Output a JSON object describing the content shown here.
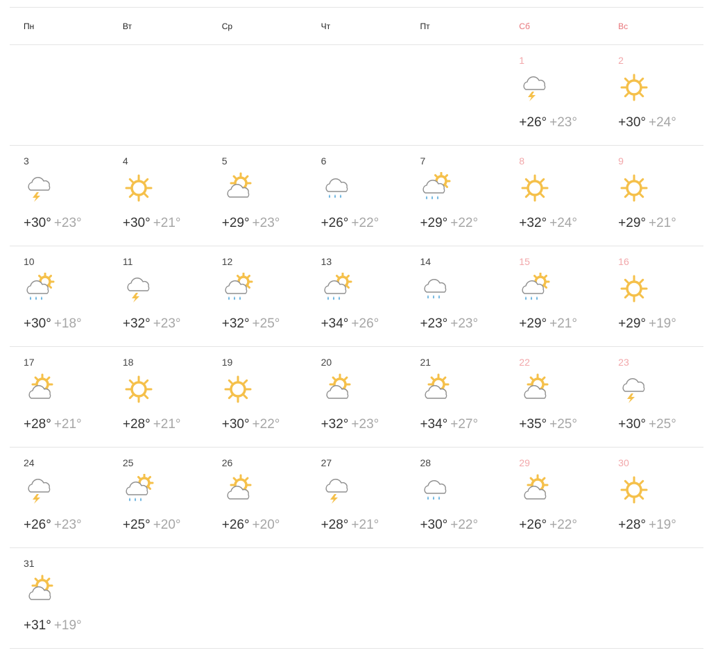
{
  "weekdays": [
    {
      "label": "Пн",
      "weekend": false
    },
    {
      "label": "Вт",
      "weekend": false
    },
    {
      "label": "Ср",
      "weekend": false
    },
    {
      "label": "Чт",
      "weekend": false
    },
    {
      "label": "Пт",
      "weekend": false
    },
    {
      "label": "Сб",
      "weekend": true
    },
    {
      "label": "Вс",
      "weekend": true
    }
  ],
  "weeks": [
    [
      null,
      null,
      null,
      null,
      null,
      {
        "day": "1",
        "icon": "thunder",
        "max": "+26°",
        "min": "+23°",
        "weekend": true
      },
      {
        "day": "2",
        "icon": "sun",
        "max": "+30°",
        "min": "+24°",
        "weekend": true
      }
    ],
    [
      {
        "day": "3",
        "icon": "thunder",
        "max": "+30°",
        "min": "+23°"
      },
      {
        "day": "4",
        "icon": "sun",
        "max": "+30°",
        "min": "+21°"
      },
      {
        "day": "5",
        "icon": "partly",
        "max": "+29°",
        "min": "+23°"
      },
      {
        "day": "6",
        "icon": "rain",
        "max": "+26°",
        "min": "+22°"
      },
      {
        "day": "7",
        "icon": "sunrain",
        "max": "+29°",
        "min": "+22°"
      },
      {
        "day": "8",
        "icon": "sun",
        "max": "+32°",
        "min": "+24°",
        "weekend": true
      },
      {
        "day": "9",
        "icon": "sun",
        "max": "+29°",
        "min": "+21°",
        "weekend": true
      }
    ],
    [
      {
        "day": "10",
        "icon": "sunrain",
        "max": "+30°",
        "min": "+18°"
      },
      {
        "day": "11",
        "icon": "thunder",
        "max": "+32°",
        "min": "+23°"
      },
      {
        "day": "12",
        "icon": "sunrain",
        "max": "+32°",
        "min": "+25°"
      },
      {
        "day": "13",
        "icon": "sunrain",
        "max": "+34°",
        "min": "+26°"
      },
      {
        "day": "14",
        "icon": "rain",
        "max": "+23°",
        "min": "+23°"
      },
      {
        "day": "15",
        "icon": "sunrain",
        "max": "+29°",
        "min": "+21°",
        "weekend": true
      },
      {
        "day": "16",
        "icon": "sun",
        "max": "+29°",
        "min": "+19°",
        "weekend": true
      }
    ],
    [
      {
        "day": "17",
        "icon": "partly",
        "max": "+28°",
        "min": "+21°"
      },
      {
        "day": "18",
        "icon": "sun",
        "max": "+28°",
        "min": "+21°"
      },
      {
        "day": "19",
        "icon": "sun",
        "max": "+30°",
        "min": "+22°"
      },
      {
        "day": "20",
        "icon": "partly",
        "max": "+32°",
        "min": "+23°"
      },
      {
        "day": "21",
        "icon": "partly",
        "max": "+34°",
        "min": "+27°"
      },
      {
        "day": "22",
        "icon": "partly",
        "max": "+35°",
        "min": "+25°",
        "weekend": true
      },
      {
        "day": "23",
        "icon": "thunder",
        "max": "+30°",
        "min": "+25°",
        "weekend": true
      }
    ],
    [
      {
        "day": "24",
        "icon": "thunder",
        "max": "+26°",
        "min": "+23°"
      },
      {
        "day": "25",
        "icon": "sunrain",
        "max": "+25°",
        "min": "+20°"
      },
      {
        "day": "26",
        "icon": "partly",
        "max": "+26°",
        "min": "+20°"
      },
      {
        "day": "27",
        "icon": "thunder",
        "max": "+28°",
        "min": "+21°"
      },
      {
        "day": "28",
        "icon": "rain",
        "max": "+30°",
        "min": "+22°"
      },
      {
        "day": "29",
        "icon": "partly",
        "max": "+26°",
        "min": "+22°",
        "weekend": true
      },
      {
        "day": "30",
        "icon": "sun",
        "max": "+28°",
        "min": "+19°",
        "weekend": true
      }
    ],
    [
      {
        "day": "31",
        "icon": "partly",
        "max": "+31°",
        "min": "+19°"
      },
      null,
      null,
      null,
      null,
      null,
      null
    ]
  ],
  "icon_names": {
    "sun": "sun-icon",
    "partly": "partly-cloudy-icon",
    "rain": "rain-icon",
    "sunrain": "sun-rain-icon",
    "thunder": "thunderstorm-icon"
  },
  "colors": {
    "sun": "#f5c04a",
    "cloud_stroke": "#8f8f8f",
    "rain": "#6fb6e0",
    "lightning": "#f5c04a",
    "weekend": "#e8757a"
  }
}
